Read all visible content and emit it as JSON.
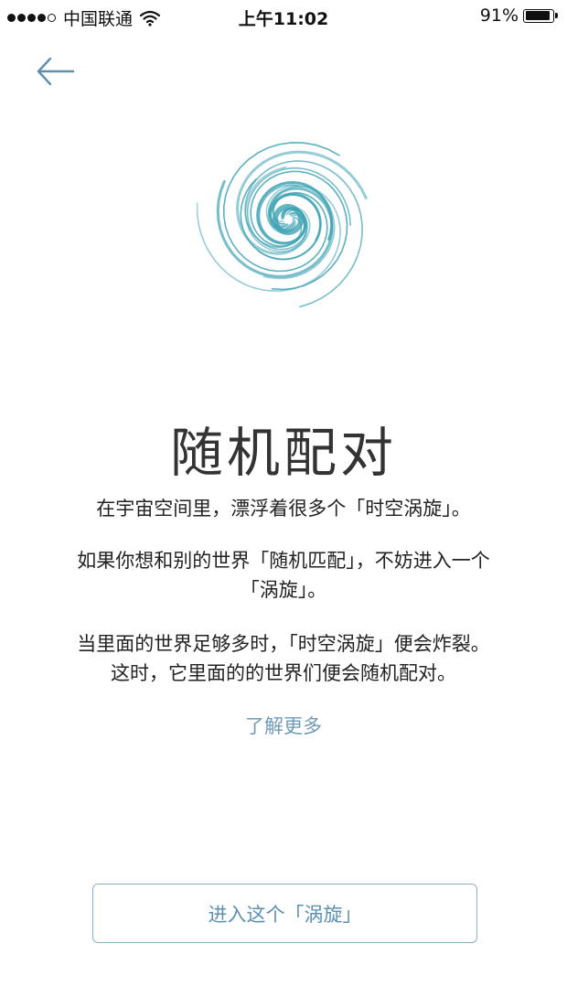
{
  "status_bar": {
    "carrier": "中国联通",
    "time": "上午11:02",
    "battery_percent_label": "91%",
    "battery_level": 0.91,
    "signal_bars_filled": 4,
    "signal_bars_total": 5
  },
  "icons": {
    "back": "arrow-left-icon",
    "wifi": "wifi-icon",
    "battery": "battery-icon",
    "vortex": "spiral-vortex-icon"
  },
  "colors": {
    "accent": "#5d8fb3",
    "vortex": "#3fa3b4",
    "button_border": "#8ab0c8"
  },
  "main": {
    "title": "随机配对",
    "paragraph_1": "在宇宙空间里，漂浮着很多个「时空涡旋」。",
    "paragraph_2_line_1": "如果你想和别的世界「随机匹配」，不妨进入一个",
    "paragraph_2_line_2": "「涡旋」。",
    "paragraph_3_line_1": "当里面的世界足够多时，「时空涡旋」便会炸裂。",
    "paragraph_3_line_2": "这时，它里面的的世界们便会随机配对。",
    "learn_more": "了解更多",
    "enter_button": "进入这个「涡旋」"
  }
}
